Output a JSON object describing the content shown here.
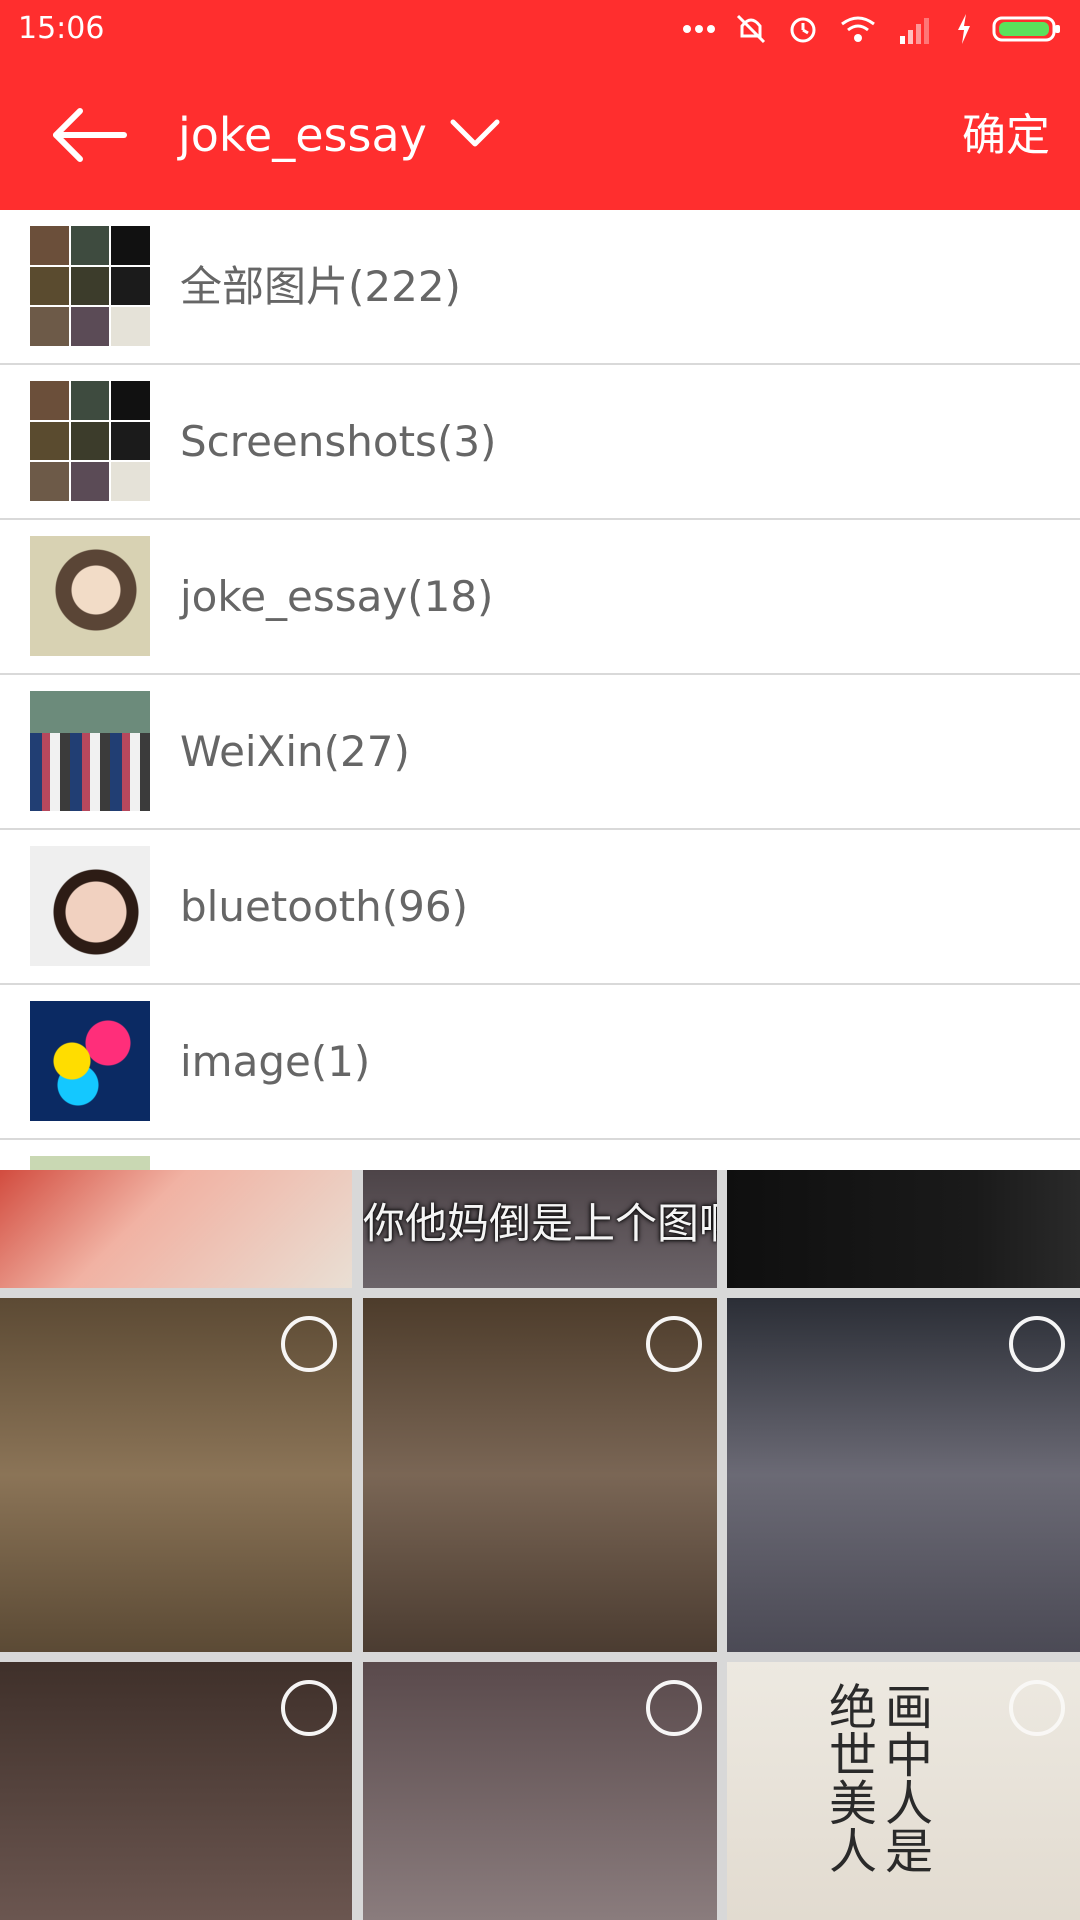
{
  "status_bar": {
    "time": "15:06"
  },
  "app_bar": {
    "back_icon": "arrow-left-icon",
    "title": "joke_essay",
    "dropdown_icon": "chevron-down-icon",
    "confirm_label": "确定"
  },
  "colors": {
    "primary": "#ff2e2e",
    "text_secondary": "#666666",
    "divider": "#d9d9d9"
  },
  "albums": [
    {
      "label": "全部图片(222)",
      "thumb": "mosaic"
    },
    {
      "label": "Screenshots(3)",
      "thumb": "mosaic"
    },
    {
      "label": "joke_essay(18)",
      "thumb": "portrait"
    },
    {
      "label": "WeiXin(27)",
      "thumb": "group-photo"
    },
    {
      "label": "bluetooth(96)",
      "thumb": "child-photo"
    },
    {
      "label": "image(1)",
      "thumb": "poster"
    }
  ],
  "photo_grid": {
    "caption": "你他妈倒是上个图啊",
    "vertical_text": "画中人是绝世美人"
  }
}
